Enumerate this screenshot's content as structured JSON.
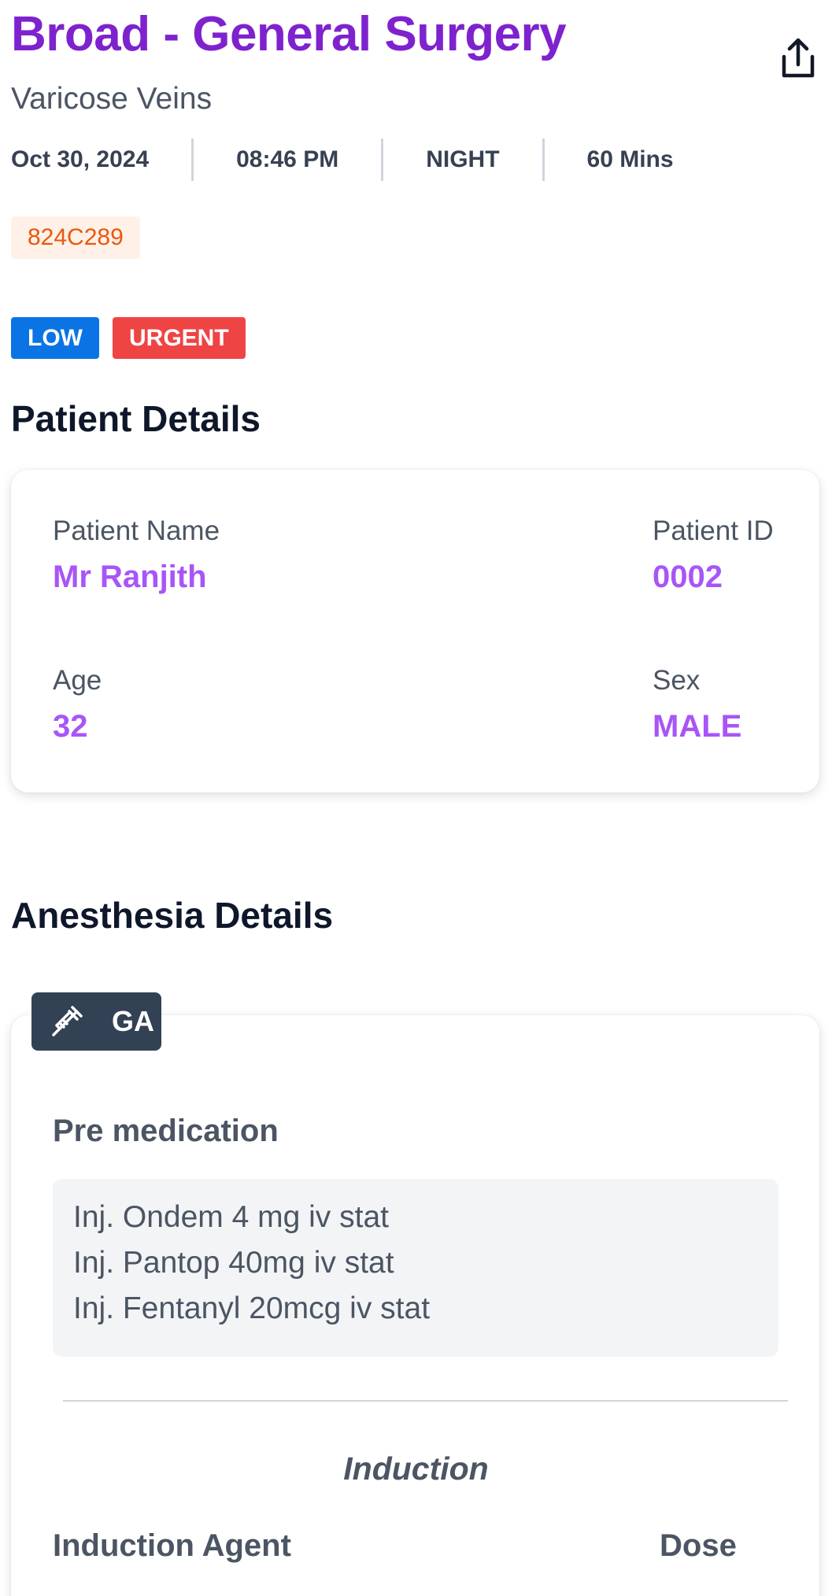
{
  "header": {
    "title": "Broad - General Surgery",
    "subtitle": "Varicose Veins",
    "share_icon": "share-icon"
  },
  "meta": {
    "date": "Oct 30, 2024",
    "time": "08:46 PM",
    "shift": "NIGHT",
    "duration": "60 Mins"
  },
  "case_code": "824C289",
  "badges": {
    "priority": "LOW",
    "urgency": "URGENT"
  },
  "patient_details": {
    "heading": "Patient Details",
    "name_label": "Patient Name",
    "name": "Mr Ranjith",
    "id_label": "Patient ID",
    "id": "0002",
    "age_label": "Age",
    "age": "32",
    "sex_label": "Sex",
    "sex": "MALE"
  },
  "anesthesia_details": {
    "heading": "Anesthesia Details",
    "type_icon": "syringe-icon",
    "type": "GA",
    "premedication_label": "Pre medication",
    "premedication": [
      "Inj. Ondem 4 mg iv stat",
      "Inj. Pantop 40mg iv stat",
      "Inj. Fentanyl 20mcg iv stat"
    ],
    "induction_title": "Induction",
    "columns": [
      "Induction Agent",
      "Dose"
    ]
  },
  "colors": {
    "title": "#7e22ce",
    "value": "#a855f7",
    "low_badge": "#0b74e5",
    "urgent_badge": "#ef4444",
    "code_text": "#ea580c",
    "code_bg": "#fff1e8",
    "ga_tag": "#334155"
  }
}
